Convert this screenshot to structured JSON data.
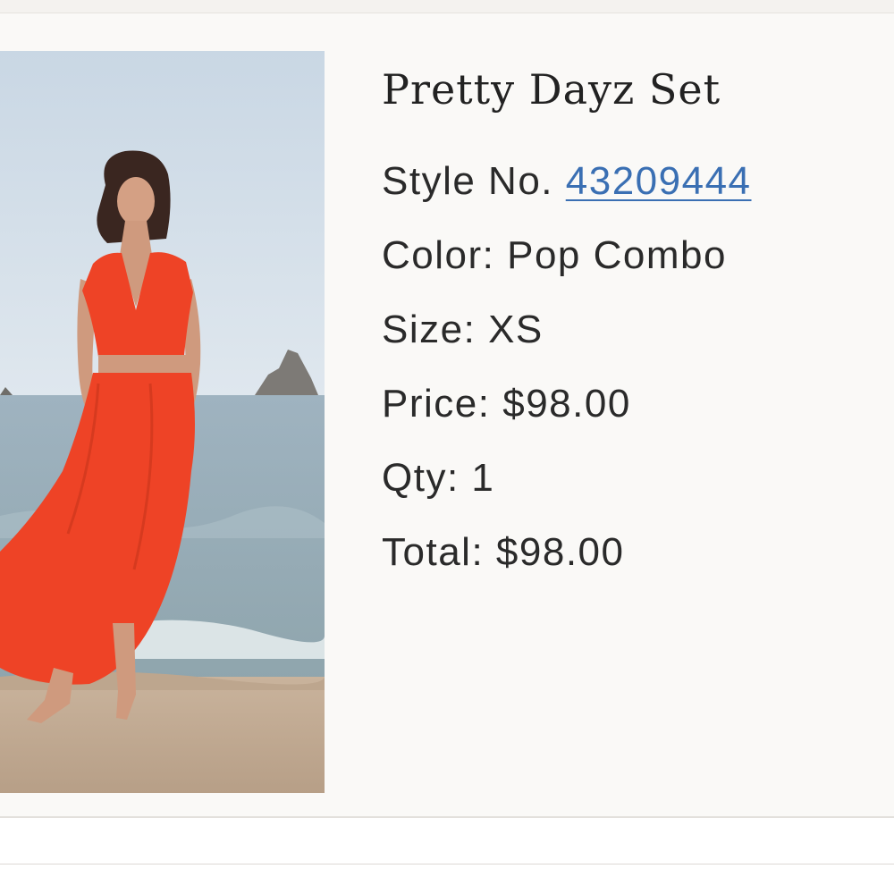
{
  "product": {
    "title": "Pretty Dayz Set",
    "image_alt": "model-beach-photo",
    "style": {
      "label": "Style No.",
      "value": "43209444"
    },
    "color": {
      "label": "Color:",
      "value": "Pop Combo"
    },
    "size": {
      "label": "Size:",
      "value": "XS"
    },
    "price": {
      "label": "Price:",
      "value": "$98.00"
    },
    "qty": {
      "label": "Qty:",
      "value": "1"
    },
    "total": {
      "label": "Total:",
      "value": "$98.00"
    }
  },
  "colors": {
    "link": "#3a6fb3",
    "dress": "#ee4326",
    "card_bg": "#faf9f7"
  }
}
